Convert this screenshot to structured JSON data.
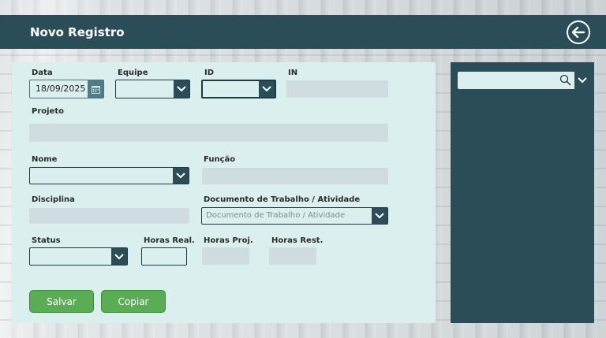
{
  "header": {
    "title": "Novo Registro"
  },
  "form": {
    "data_label": "Data",
    "data_value": "18/09/2025",
    "equipe_label": "Equipe",
    "id_label": "ID",
    "in_label": "IN",
    "projeto_label": "Projeto",
    "nome_label": "Nome",
    "funcao_label": "Função",
    "disciplina_label": "Disciplina",
    "documento_label": "Documento de Trabalho / Atividade",
    "documento_placeholder": "Documento de Trabalho / Atividade",
    "status_label": "Status",
    "horas_real_label": "Horas Real.",
    "horas_proj_label": "Horas Proj.",
    "horas_rest_label": "Horas Rest."
  },
  "actions": {
    "save_label": "Salvar",
    "copy_label": "Copiar"
  },
  "colors": {
    "header": "#2a4d57",
    "panel": "#dcefef",
    "field": "#cfdde0",
    "button": "#5aac55"
  },
  "icons": {
    "back": "arrow-left-circle-icon",
    "calendar": "calendar-icon",
    "search": "search-icon",
    "dropdown": "chevron-down-icon"
  }
}
